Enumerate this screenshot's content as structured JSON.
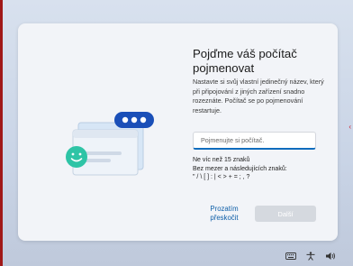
{
  "window": {
    "accent_color": "#0f6cbd",
    "edge_color": "#a01818"
  },
  "setup": {
    "title": "Pojďme váš počítač pojmenovat",
    "description": "Nastavte si svůj vlastní jedinečný název, který při připojování z jiných zařízení snadno rozeznáte. Počítač se po pojmenování restartuje.",
    "name_input": {
      "placeholder": "Pojmenujte si počítač.",
      "value": ""
    },
    "rules": {
      "line1": "Ne víc než 15 znaků",
      "line2": "Bez mezer a následujících znaků:",
      "line3": "\" / \\ [ ] : | < > + = ; , ?"
    },
    "skip_label_line1": "Prozatím",
    "skip_label_line2": "přeskočit",
    "next_label": "Další"
  },
  "taskbar": {
    "icons": [
      "keyboard-icon",
      "accessibility-icon",
      "volume-icon"
    ]
  }
}
